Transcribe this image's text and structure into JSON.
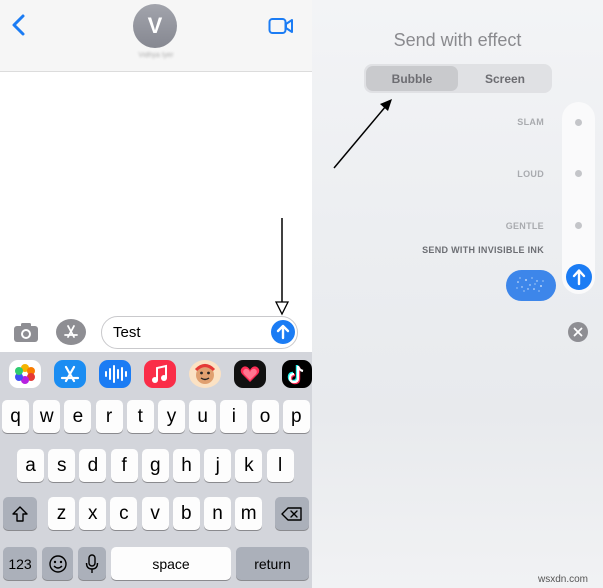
{
  "left": {
    "header": {
      "avatar_initial": "V",
      "contact_name": "Vidhya Iyer"
    },
    "composer": {
      "message_text": "Test"
    },
    "app_strip": [
      {
        "name": "photos-app-icon",
        "bg": "#ffffff"
      },
      {
        "name": "app-store-app-icon",
        "bg": "#1b8df2"
      },
      {
        "name": "audio-message-app-icon",
        "bg": "#1b7cf4"
      },
      {
        "name": "music-app-icon",
        "bg": "#fa2d48"
      },
      {
        "name": "memoji-app-icon",
        "bg": "#fbe2c4"
      },
      {
        "name": "digital-touch-app-icon",
        "bg": "#111111"
      },
      {
        "name": "tiktok-app-icon",
        "bg": "#000000"
      }
    ],
    "keyboard": {
      "row1": [
        "q",
        "w",
        "e",
        "r",
        "t",
        "y",
        "u",
        "i",
        "o",
        "p"
      ],
      "row2": [
        "a",
        "s",
        "d",
        "f",
        "g",
        "h",
        "j",
        "k",
        "l"
      ],
      "row3": [
        "z",
        "x",
        "c",
        "v",
        "b",
        "n",
        "m"
      ],
      "numbers_key": "123",
      "space_key": "space",
      "return_key": "return"
    }
  },
  "right": {
    "title": "Send with effect",
    "tabs": [
      {
        "label": "Bubble",
        "selected": true
      },
      {
        "label": "Screen",
        "selected": false
      }
    ],
    "effects": [
      "SLAM",
      "LOUD",
      "GENTLE",
      "SEND WITH INVISIBLE INK"
    ]
  },
  "watermark": "wsxdn.com",
  "colors": {
    "accent_blue": "#1b7cf4",
    "bubble_blue": "#3d86ea"
  }
}
